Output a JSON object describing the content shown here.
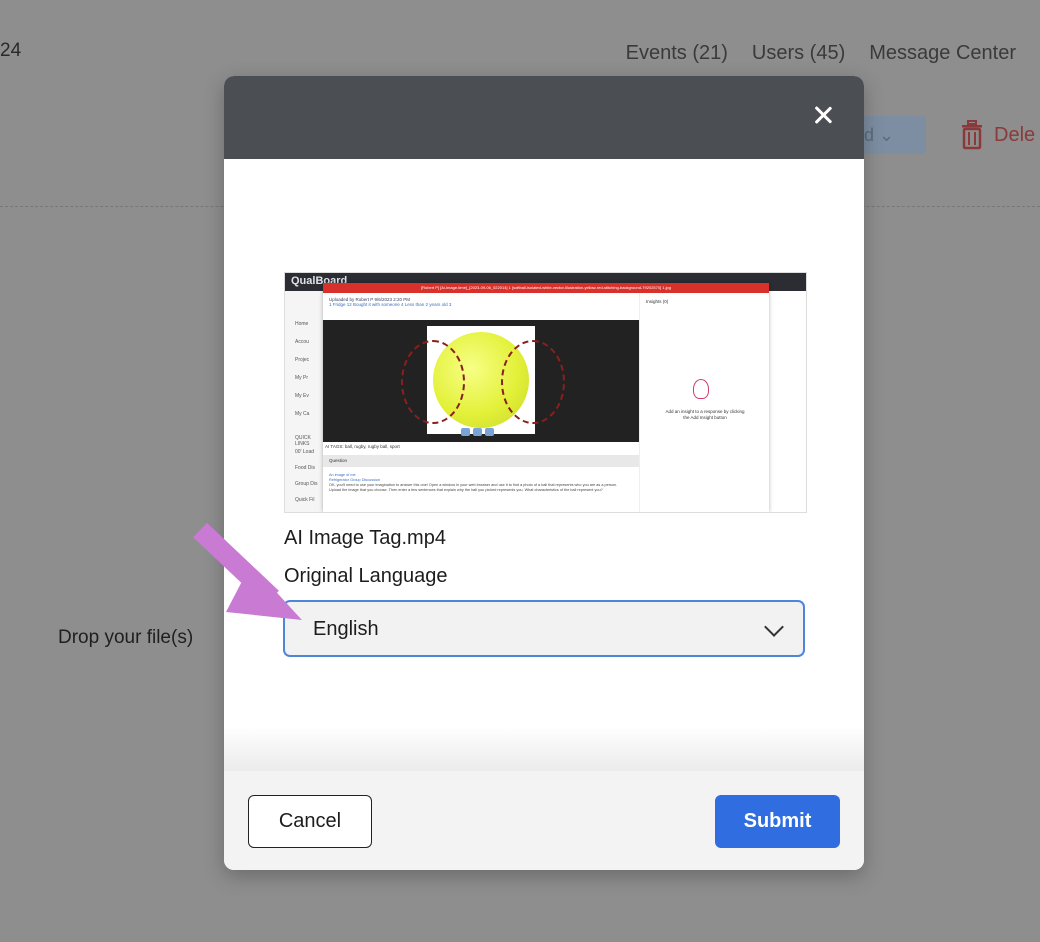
{
  "background": {
    "left_text": "24",
    "nav": [
      "Events (21)",
      "Users (45)",
      "Message Center"
    ],
    "dropdown_label": "d",
    "delete_label": "Dele",
    "drop_text": "Drop your file(s)"
  },
  "modal": {
    "preview": {
      "app_name": "QualBoard",
      "sidebar_items": [
        "Home",
        "Accou",
        "Projec",
        "My Pr",
        "My Ev",
        "My Ca",
        "QUICK LINKS",
        "00' Load",
        "Food Dis",
        "Group Dis",
        "Quick Fil"
      ],
      "dialog_title": "[Robert P] [Ai-image-time]_[2023-09-06_022014] 1 [softball-isolated-white-vector-illustration-yellow-red-stitching-background-79202570] 1.jpg",
      "upload_line": "Uploaded by Robert P  9/6/2023 2:20 PM",
      "tags_line": "1 Fridge 12   Bought it with someone 4   Less than 2 years old 3",
      "ai_tags": "AI TAGS:  ball, rugby, rugby ball, sport",
      "question_label": "Question",
      "comment_title": "An image of me",
      "comment_sub": "Refrigerator Group Discussion",
      "comment_body": "OK, you'll need to use your imagination to answer this one! Open a window in your web browser and use it to find a photo of a ball that represents who you are as a person. Upload the image that you choose. Then enter a few sentences that explain why the ball you picked represents you. What characteristics of the ball represent you?",
      "insights_title": "Insights (0)",
      "insights_text": "Add an insight to a response by clicking the Add Insight button"
    },
    "filename": "AI Image Tag.mp4",
    "language_label": "Original Language",
    "language_value": "English",
    "cancel_label": "Cancel",
    "submit_label": "Submit"
  },
  "colors": {
    "overlay": "#8e8e8e",
    "header": "#4b4e52",
    "submit": "#2f6de0",
    "select_border": "#4e86d9",
    "arrow": "#c97ad2"
  }
}
